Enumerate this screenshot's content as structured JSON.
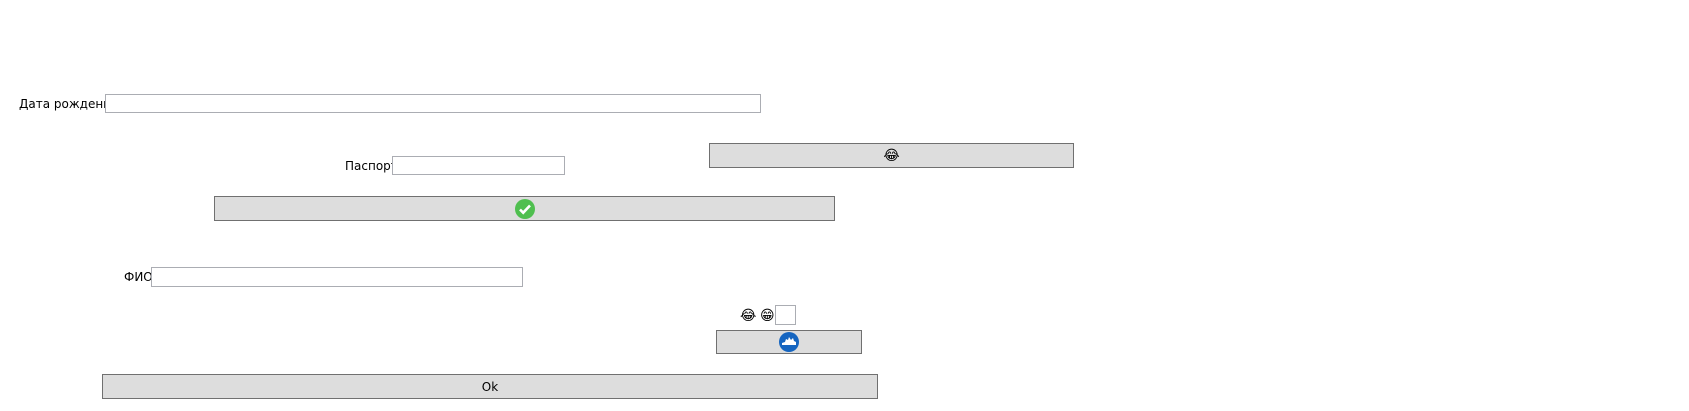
{
  "form": {
    "birth_date_label": "Дата рождения",
    "birth_date_value": "",
    "passport_label": "Паспорт",
    "passport_value": "",
    "fio_label": "ФИО",
    "fio_value": "",
    "small_box_value": "",
    "emoji_1": "😂",
    "emoji_2": "😁",
    "emoji_button_glyph": "😂",
    "ok_label": "Ok"
  },
  "colors": {
    "check": "#4fbf4f",
    "blue_icon": "#1565c0",
    "button_bg": "#dddddd"
  }
}
